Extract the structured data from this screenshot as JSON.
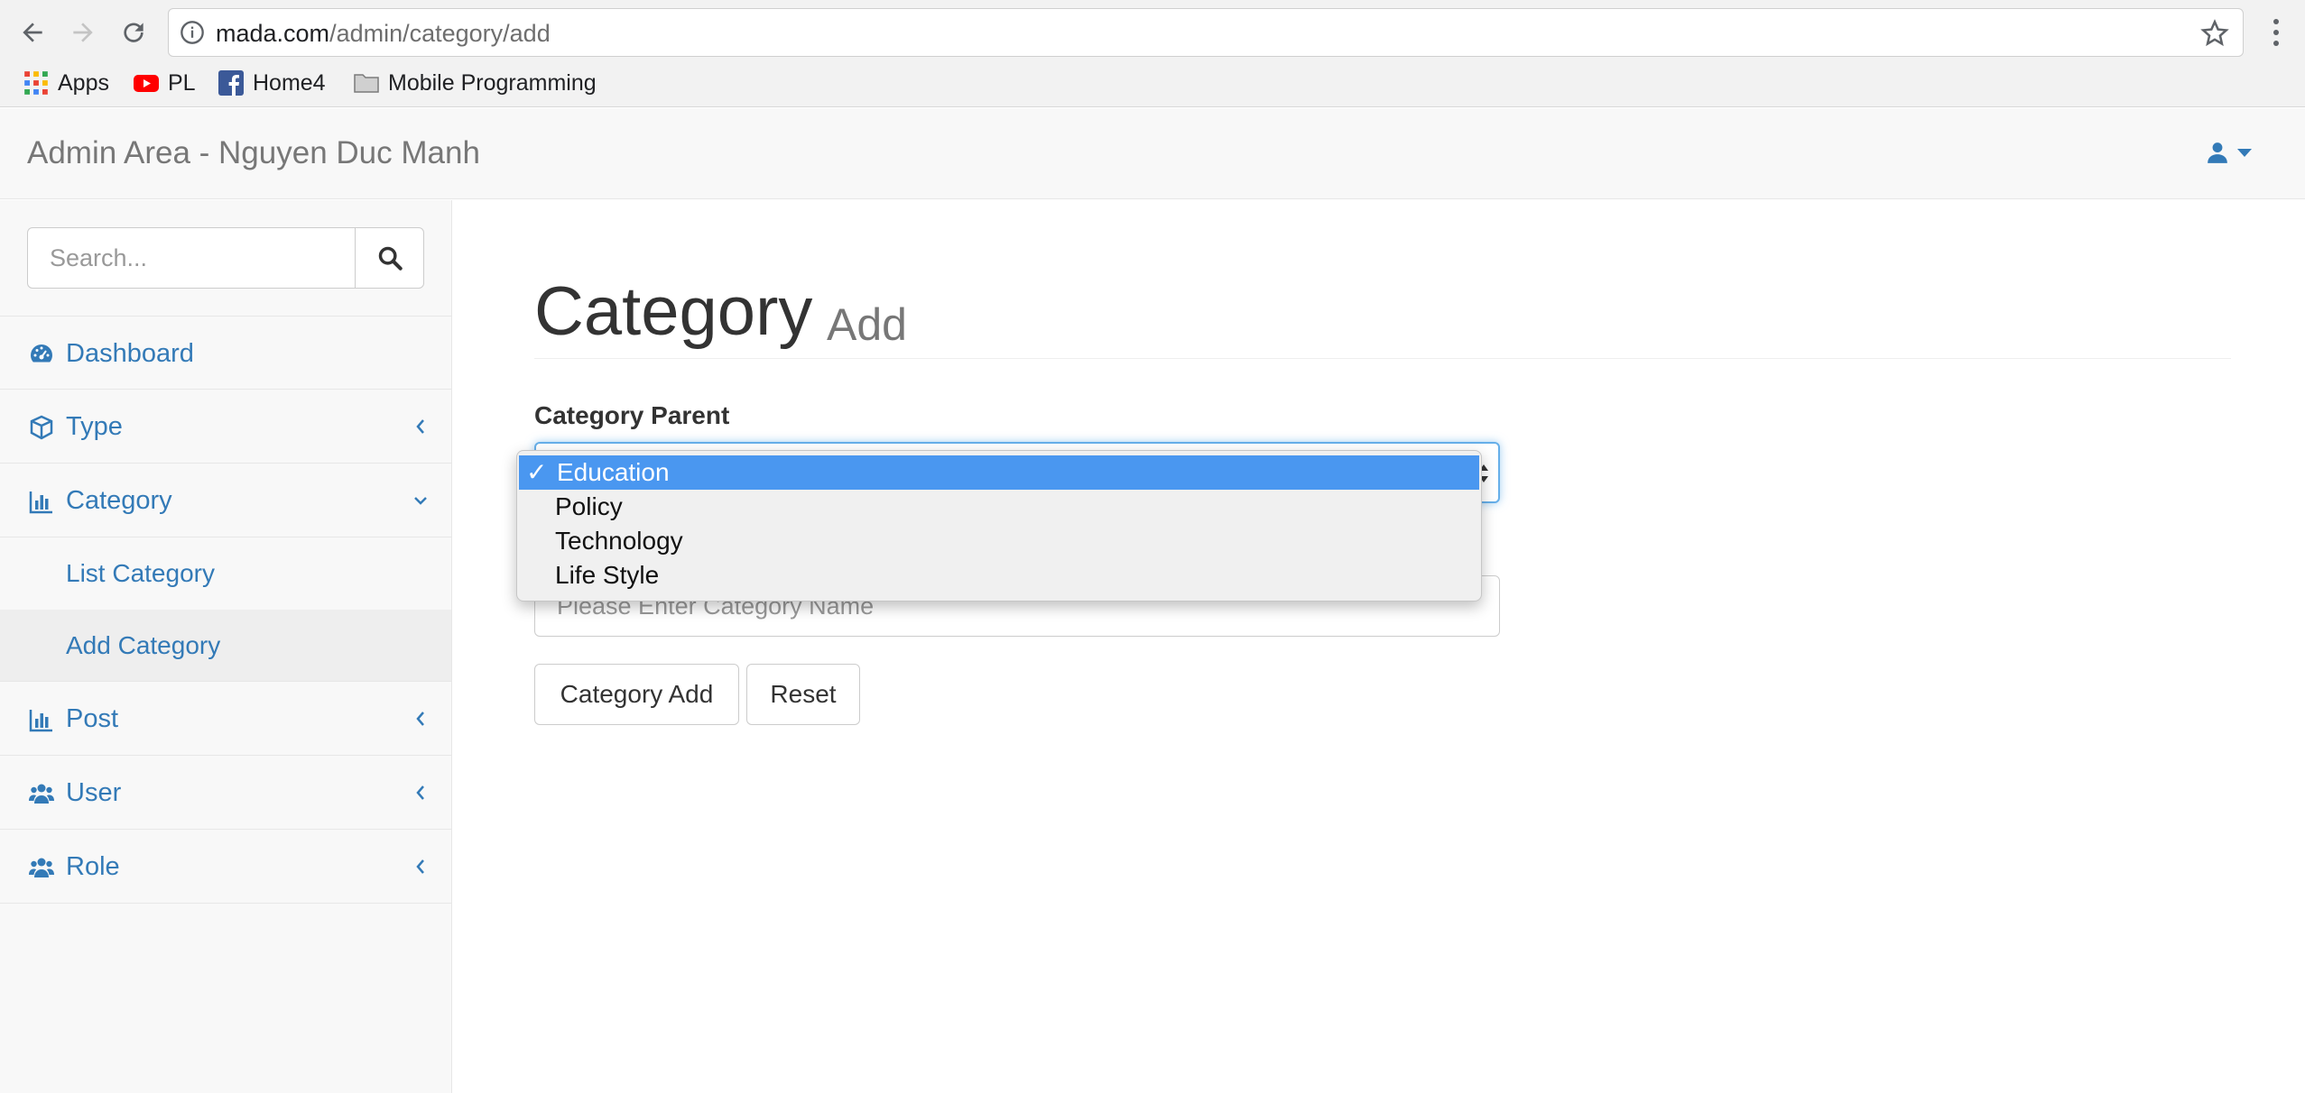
{
  "browser": {
    "url_host": "mada.com",
    "url_path": "/admin/category/add",
    "bookmarks": [
      {
        "label": "Apps",
        "icon": "apps-grid-icon"
      },
      {
        "label": "PL",
        "icon": "youtube-icon"
      },
      {
        "label": "Home4",
        "icon": "facebook-icon"
      },
      {
        "label": "Mobile Programming",
        "icon": "folder-icon"
      }
    ]
  },
  "navbar": {
    "brand": "Admin Area - Nguyen Duc Manh",
    "user_icon": "user-icon"
  },
  "sidebar": {
    "search_placeholder": "Search...",
    "items": [
      {
        "label": "Dashboard",
        "icon": "dashboard-icon",
        "chevron": ""
      },
      {
        "label": "Type",
        "icon": "cube-icon",
        "chevron": "left"
      },
      {
        "label": "Category",
        "icon": "bar-chart-icon",
        "chevron": "down"
      },
      {
        "label": "Post",
        "icon": "bar-chart-icon",
        "chevron": "left"
      },
      {
        "label": "User",
        "icon": "users-icon",
        "chevron": "left"
      },
      {
        "label": "Role",
        "icon": "users-icon",
        "chevron": "left"
      }
    ],
    "subitems": [
      {
        "label": "List Category",
        "active": false
      },
      {
        "label": "Add Category",
        "active": true
      }
    ]
  },
  "main": {
    "title": "Category",
    "subtitle": "Add",
    "parent_label": "Category Parent",
    "name_placeholder": "Please Enter Category Name",
    "add_button": "Category Add",
    "reset_button": "Reset"
  },
  "dropdown": {
    "check": "✓",
    "options": [
      "Education",
      "Policy",
      "Technology",
      "Life Style"
    ],
    "selected": "Education"
  },
  "colors": {
    "link": "#337ab7",
    "selected_option": "#4a97f0",
    "focus_border": "#66afe9"
  }
}
